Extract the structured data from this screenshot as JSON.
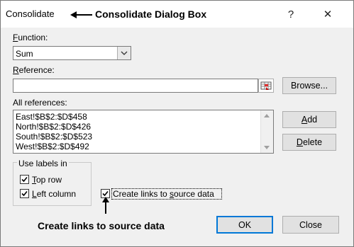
{
  "dialog": {
    "title": "Consolidate",
    "help": "?",
    "close_glyph": "✕"
  },
  "annotations": {
    "title_callout": "Consolidate Dialog Box",
    "links_callout": "Create links to source data"
  },
  "function": {
    "label_u": "F",
    "label_rest": "unction:",
    "value": "Sum"
  },
  "reference": {
    "label_u": "R",
    "label_rest": "eference:",
    "value": "",
    "browse_label": "Browse..."
  },
  "all_references": {
    "label": "All references:",
    "items": [
      "East!$B$2:$D$458",
      "North!$B$2:$D$426",
      "South!$B$2:$D$523",
      "West!$B$2:$D$492"
    ],
    "add_u": "A",
    "add_rest": "dd",
    "delete_u": "D",
    "delete_rest": "elete"
  },
  "labels_group": {
    "title": "Use labels in",
    "top_row_u": "T",
    "top_row_rest": "op row",
    "top_row_checked": true,
    "left_column_u": "L",
    "left_column_rest": "eft column",
    "left_column_checked": true
  },
  "links": {
    "pre": "Create links to ",
    "u": "s",
    "rest": "ource data",
    "checked": true
  },
  "buttons": {
    "ok": "OK",
    "close": "Close"
  },
  "colors": {
    "accent": "#0078d7",
    "dialog_bg": "#f0f0f0"
  }
}
